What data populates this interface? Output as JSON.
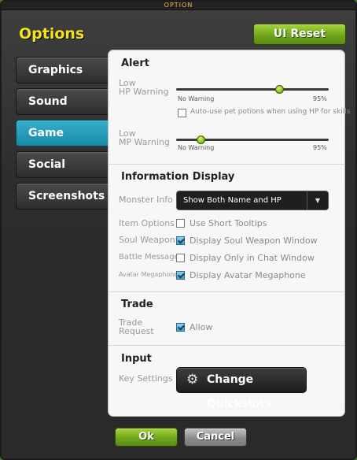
{
  "window": {
    "title": "OPTION"
  },
  "header": {
    "heading": "Options",
    "reset_label": "UI Reset"
  },
  "tabs": [
    {
      "label": "Graphics",
      "active": false
    },
    {
      "label": "Sound",
      "active": false
    },
    {
      "label": "Game",
      "active": true
    },
    {
      "label": "Social",
      "active": false
    },
    {
      "label": "Screenshots",
      "active": false
    }
  ],
  "alert": {
    "title": "Alert",
    "hp_label_1": "Low",
    "hp_label_2": "HP Warning",
    "hp_value_fraction": 0.68,
    "hp_min": "No Warning",
    "hp_max": "95%",
    "autouse_label": "Auto-use pet potions when using HP for skills",
    "autouse_checked": false,
    "mp_label_1": "Low",
    "mp_label_2": "MP Warning",
    "mp_value_fraction": 0.16,
    "mp_min": "No Warning",
    "mp_max": "95%"
  },
  "info": {
    "title": "Information Display",
    "monster_label": "Monster Info",
    "monster_value": "Show Both Name and HP",
    "monster_arrow": "▼",
    "item_label": "Item Options",
    "item_text": "Use Short Tooltips",
    "item_checked": false,
    "soul_label": "Soul Weapon",
    "soul_text": "Display Soul Weapon Window",
    "soul_checked": true,
    "battle_label": "Battle Messages",
    "battle_text": "Display Only in Chat Window",
    "battle_checked": false,
    "avatar_label": "Avatar Megaphone",
    "avatar_text": "Display Avatar Megaphone",
    "avatar_checked": true
  },
  "trade": {
    "title": "Trade",
    "label_1": "Trade",
    "label_2": "Request",
    "text": "Allow",
    "checked": true
  },
  "input": {
    "title": "Input",
    "key_label": "Key Settings",
    "button_label": "Change Quickslots",
    "icon": "gear-icon"
  },
  "footer": {
    "ok_label": "Ok",
    "cancel_label": "Cancel"
  },
  "colors": {
    "accent_green": "#8dc21e",
    "heading_yellow": "#f4e21a",
    "active_tab": "#1a88a8"
  }
}
